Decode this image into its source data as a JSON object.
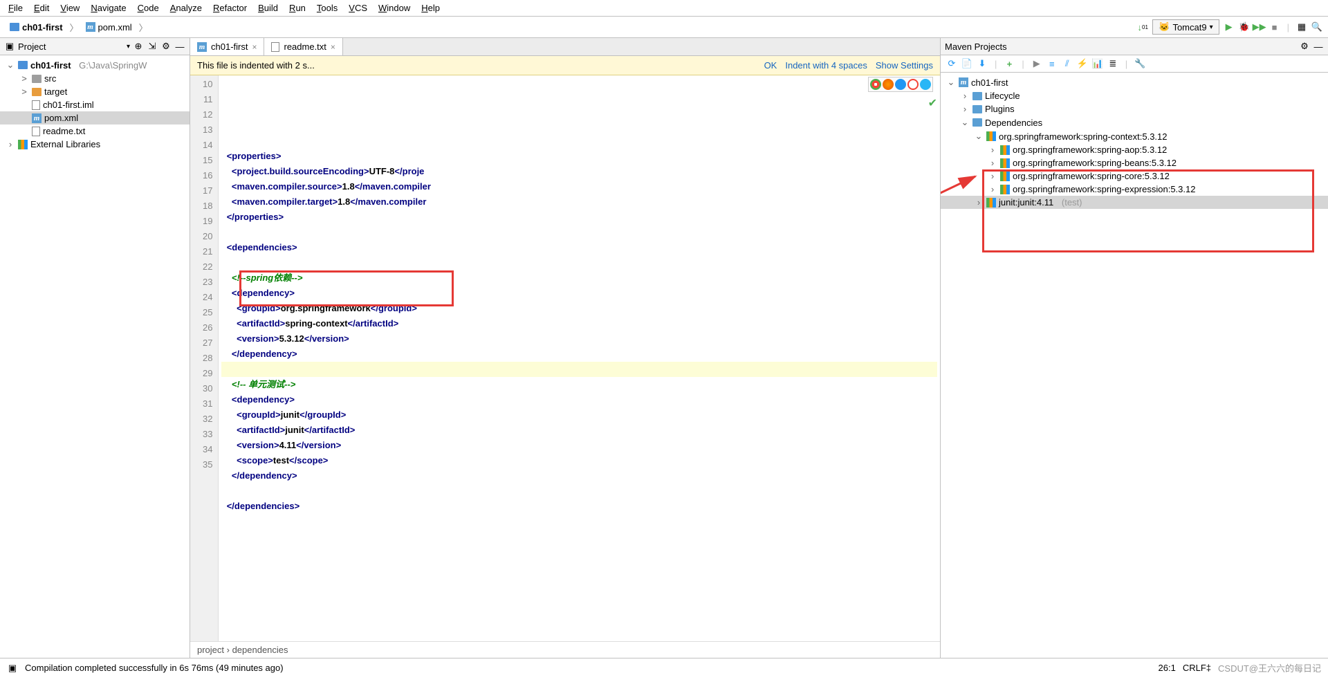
{
  "menu": [
    "File",
    "Edit",
    "View",
    "Navigate",
    "Code",
    "Analyze",
    "Refactor",
    "Build",
    "Run",
    "Tools",
    "VCS",
    "Window",
    "Help"
  ],
  "breadcrumb": {
    "project": "ch01-first",
    "file": "pom.xml"
  },
  "toolbar": {
    "runconfig": "Tomcat9"
  },
  "project_panel": {
    "title": "Project",
    "root": "ch01-first",
    "root_path": "G:\\Java\\SpringW",
    "items": [
      {
        "d": 1,
        "exp": ">",
        "icon": "folder-gray",
        "label": "src"
      },
      {
        "d": 1,
        "exp": ">",
        "icon": "folder-orange",
        "label": "target"
      },
      {
        "d": 1,
        "exp": "",
        "icon": "file",
        "label": "ch01-first.iml"
      },
      {
        "d": 1,
        "exp": "",
        "icon": "m",
        "label": "pom.xml",
        "sel": true
      },
      {
        "d": 1,
        "exp": "",
        "icon": "file",
        "label": "readme.txt"
      }
    ],
    "ext_lib": "External Libraries"
  },
  "tabs": [
    {
      "icon": "m",
      "label": "ch01-first",
      "close": true
    },
    {
      "icon": "file",
      "label": "readme.txt",
      "close": true
    }
  ],
  "notification": {
    "msg": "This file is indented with 2 s...",
    "ok": "OK",
    "indent": "Indent with 4 spaces",
    "show": "Show Settings"
  },
  "code": {
    "start": 10,
    "lines": [
      {
        "n": 10,
        "html": ""
      },
      {
        "n": 11,
        "html": ""
      },
      {
        "n": 12,
        "html": "  <span class='tag'>&lt;properties&gt;</span>"
      },
      {
        "n": 13,
        "html": "    <span class='tag'>&lt;project.build.sourceEncoding&gt;</span><span class='txt'>UTF-8</span><span class='tag'>&lt;/proje</span>"
      },
      {
        "n": 14,
        "html": "    <span class='tag'>&lt;maven.compiler.source&gt;</span><span class='txt'>1.8</span><span class='tag'>&lt;/maven.compiler</span>"
      },
      {
        "n": 15,
        "html": "    <span class='tag'>&lt;maven.compiler.target&gt;</span><span class='txt'>1.8</span><span class='tag'>&lt;/maven.compiler</span>"
      },
      {
        "n": 16,
        "html": "  <span class='tag'>&lt;/properties&gt;</span>"
      },
      {
        "n": 17,
        "html": ""
      },
      {
        "n": 18,
        "html": "  <span class='tag'>&lt;dependencies&gt;</span>"
      },
      {
        "n": 19,
        "html": ""
      },
      {
        "n": 20,
        "html": "    <span class='cmt'>&lt;!--spring依赖--&gt;</span>"
      },
      {
        "n": 21,
        "html": "    <span class='tag'>&lt;dependency&gt;</span>"
      },
      {
        "n": 22,
        "html": "      <span class='tag'>&lt;groupId&gt;</span><span class='txt'>org.springframework</span><span class='tag'>&lt;/groupId&gt;</span>"
      },
      {
        "n": 23,
        "html": "      <span class='tag'>&lt;artifactId&gt;</span><span class='txt'>spring-context</span><span class='tag'>&lt;/artifactId&gt;</span>"
      },
      {
        "n": 24,
        "html": "      <span class='tag'>&lt;version&gt;</span><span class='txt'>5.3.12</span><span class='tag'>&lt;/version&gt;</span>"
      },
      {
        "n": 25,
        "html": "    <span class='tag'>&lt;/dependency&gt;</span>"
      },
      {
        "n": 26,
        "html": "",
        "hl": true
      },
      {
        "n": 27,
        "html": "    <span class='cmt'>&lt;!-- 单元测试--&gt;</span>"
      },
      {
        "n": 28,
        "html": "    <span class='tag'>&lt;dependency&gt;</span>"
      },
      {
        "n": 29,
        "html": "      <span class='tag'>&lt;groupId&gt;</span><span class='txt'>junit</span><span class='tag'>&lt;/groupId&gt;</span>"
      },
      {
        "n": 30,
        "html": "      <span class='tag'>&lt;artifactId&gt;</span><span class='txt'>junit</span><span class='tag'>&lt;/artifactId&gt;</span>"
      },
      {
        "n": 31,
        "html": "      <span class='tag'>&lt;version&gt;</span><span class='txt'>4.11</span><span class='tag'>&lt;/version&gt;</span>"
      },
      {
        "n": 32,
        "html": "      <span class='tag'>&lt;scope&gt;</span><span class='txt'>test</span><span class='tag'>&lt;/scope&gt;</span>"
      },
      {
        "n": 33,
        "html": "    <span class='tag'>&lt;/dependency&gt;</span>"
      },
      {
        "n": 34,
        "html": ""
      },
      {
        "n": 35,
        "html": "  <span class='tag'>&lt;/dependencies&gt;</span>"
      }
    ],
    "breadcrumb": "project   ›   dependencies"
  },
  "maven": {
    "title": "Maven Projects",
    "root": "ch01-first",
    "groups": [
      "Lifecycle",
      "Plugins",
      "Dependencies"
    ],
    "deps_parent": "org.springframework:spring-context:5.3.12",
    "deps": [
      "org.springframework:spring-aop:5.3.12",
      "org.springframework:spring-beans:5.3.12",
      "org.springframework:spring-core:5.3.12",
      "org.springframework:spring-expression:5.3.12"
    ],
    "junit": "junit:junit:4.11",
    "junit_scope": "(test)"
  },
  "status": {
    "msg": "Compilation completed successfully in 6s 76ms (49 minutes ago)",
    "pos": "26:1",
    "enc": "CRLF‡",
    "tail": "CSDUT@王六六的每日记"
  }
}
